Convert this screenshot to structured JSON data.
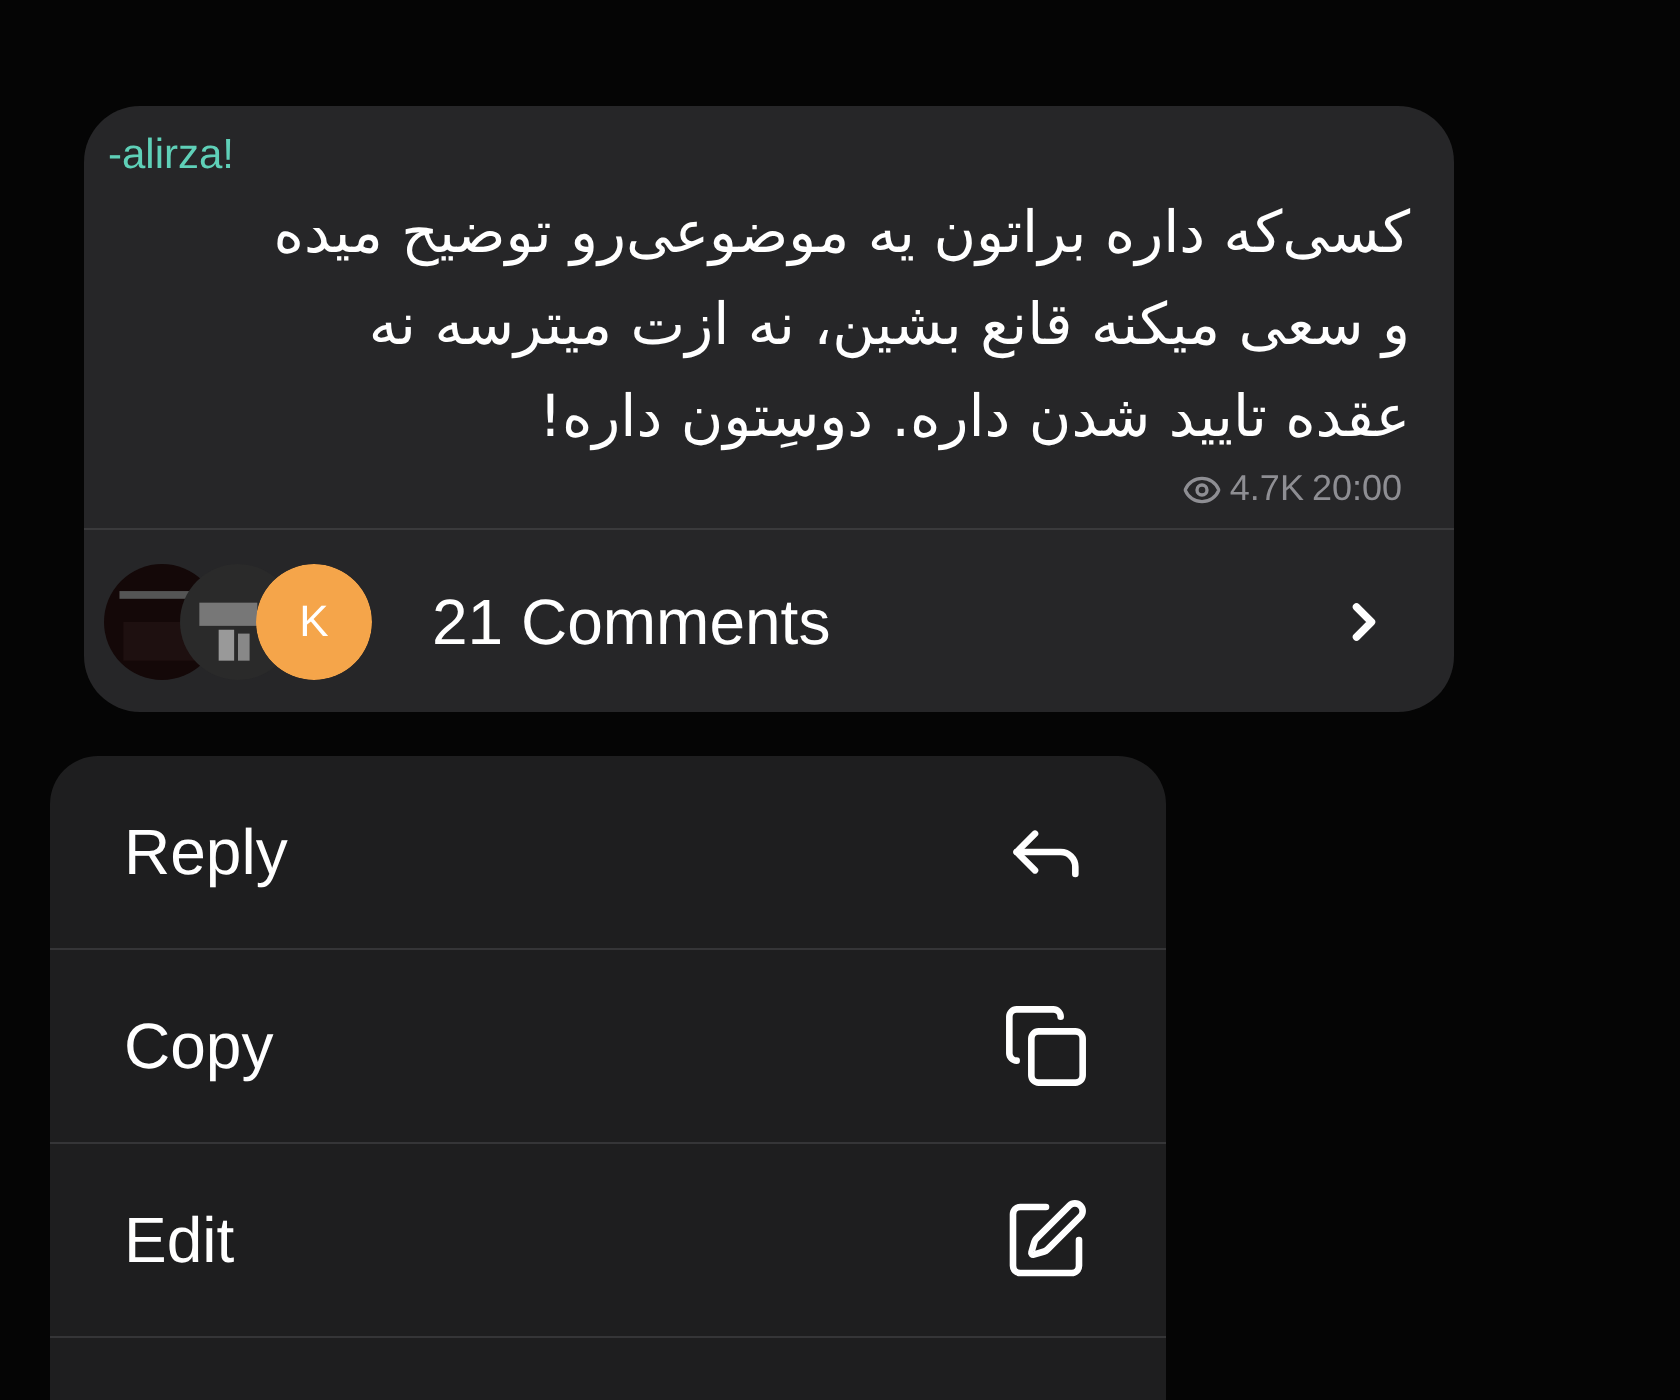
{
  "message": {
    "author": "-alirza!",
    "lines": [
      "کسی‌که داره براتون یه موضوعی‌رو توضیح میده",
      "و سعی میکنه قانع بشین، نه ازت میترسه نه",
      "عقده تایید شدن داره. دوسِتون داره!"
    ],
    "views": "4.7K",
    "time": "20:00",
    "comments": {
      "avatars": [
        {
          "kind": "picture"
        },
        {
          "kind": "picture"
        },
        {
          "kind": "letter",
          "letter": "K",
          "color": "#f5a54a"
        }
      ],
      "label": "21 Comments"
    }
  },
  "menu": [
    {
      "label": "Reply",
      "kind": "reply"
    },
    {
      "label": "Copy",
      "kind": "copy"
    },
    {
      "label": "Edit",
      "kind": "edit"
    }
  ]
}
